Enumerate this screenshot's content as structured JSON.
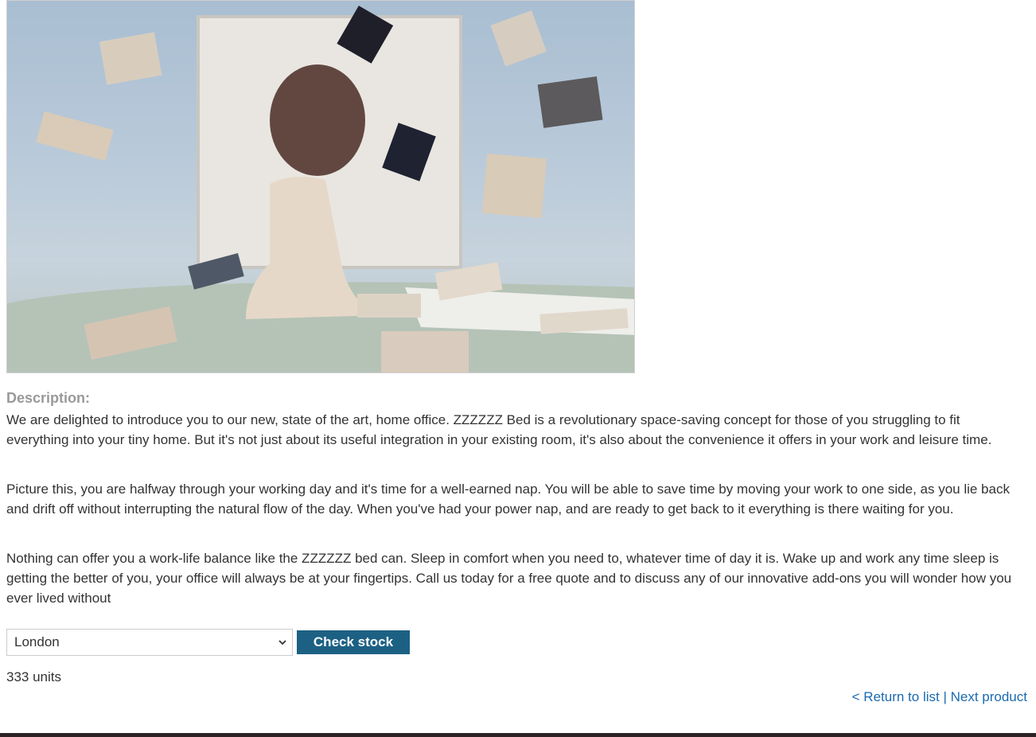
{
  "product": {
    "image_alt": "ZZZZZZ Bed product image"
  },
  "description": {
    "label": "Description:",
    "paragraphs": [
      "We are delighted to introduce you to our new, state of the art, home office. ZZZZZZ Bed is a revolutionary space-saving concept for those of you struggling to fit everything into your tiny home. But it's not just about its useful integration in your existing room, it's also about the convenience it offers in your work and leisure time.",
      "Picture this, you are halfway through your working day and it's time for a well-earned nap. You will be able to save time by moving your work to one side, as you lie back and drift off without interrupting the natural flow of the day. When you've had your power nap, and are ready to get back to it everything is there waiting for you.",
      "Nothing can offer you a work-life balance like the ZZZZZZ bed can. Sleep in comfort when you need to, whatever time of day it is. Wake up and work any time sleep is getting the better of you, your office will always be at your fingertips. Call us today for a free quote and to discuss any of our innovative add-ons you will wonder how you ever lived without"
    ]
  },
  "stock": {
    "selected_store": "London",
    "check_button_label": "Check stock",
    "result": "333 units"
  },
  "navigation": {
    "return_link": "< Return to list",
    "separator": " | ",
    "next_link": "Next product"
  },
  "colors": {
    "button_bg": "#1c6184",
    "link": "#1a6ab0",
    "label": "#999999",
    "text": "#333333"
  },
  "icons": {
    "select_arrow": "chevron-down-icon"
  }
}
